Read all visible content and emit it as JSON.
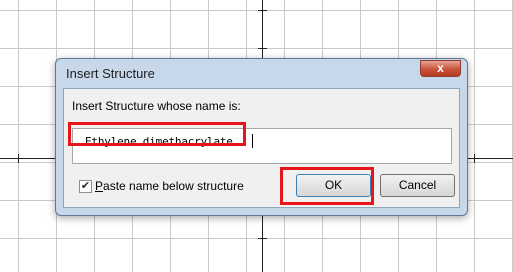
{
  "dialog": {
    "title": "Insert Structure",
    "close_label": "x",
    "prompt": "Insert Structure whose name is:",
    "name_value": "Ethylene dimethacrylate",
    "paste_below": {
      "checked": true,
      "check_glyph": "✔",
      "label_underlined": "P",
      "label_rest": "aste name below structure"
    },
    "ok_label": "OK",
    "cancel_label": "Cancel"
  },
  "highlights": {
    "color": "#e8141b"
  },
  "canvas": {
    "grid_color": "#c9c9c9",
    "axis_color": "#222222"
  }
}
